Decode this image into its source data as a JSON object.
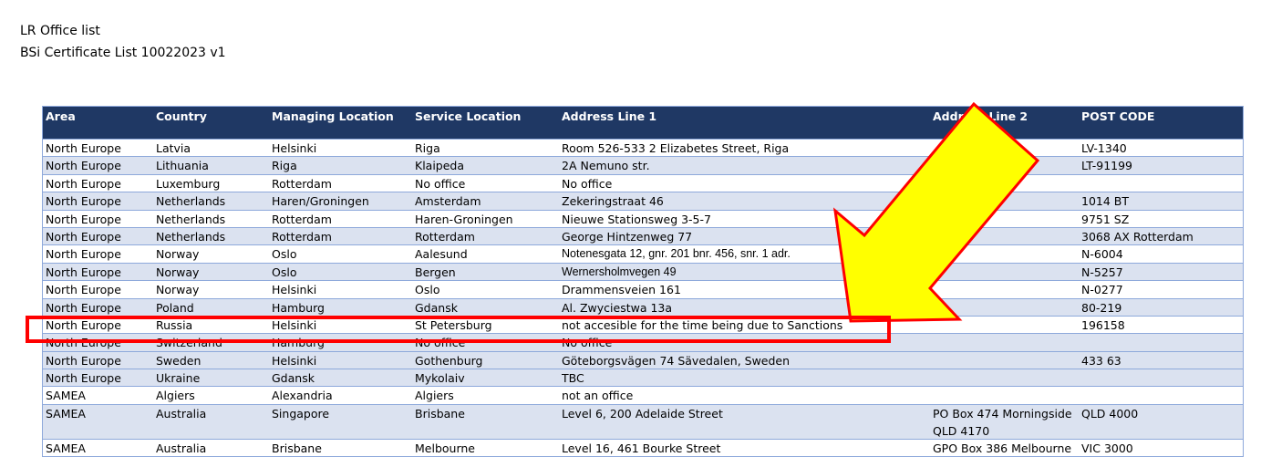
{
  "document": {
    "title_line1": "LR Office list",
    "title_line2": "BSi Certificate List 10022023 v1"
  },
  "table": {
    "headers": [
      "Area",
      "Country",
      "Managing Location",
      "Service Location",
      "Address Line 1",
      "Address Line 2",
      "POST CODE"
    ],
    "rows": [
      {
        "cells": [
          "North Europe",
          "Latvia",
          "Helsinki",
          "Riga",
          "Room 526-533  2 Elizabetes Street, Riga",
          "",
          "LV-1340"
        ]
      },
      {
        "cells": [
          "North Europe",
          "Lithuania",
          "Riga",
          "Klaipeda",
          "2A Nemuno str.",
          "",
          "LT-91199"
        ]
      },
      {
        "cells": [
          "North Europe",
          "Luxemburg",
          "Rotterdam",
          "No office",
          "No office",
          "",
          ""
        ]
      },
      {
        "cells": [
          "North Europe",
          "Netherlands",
          "Haren/Groningen",
          "Amsterdam",
          "Zekeringstraat 46",
          "",
          " 1014 BT"
        ]
      },
      {
        "cells": [
          "North Europe",
          "Netherlands",
          "Rotterdam",
          "Haren-Groningen",
          "Nieuwe Stationsweg 3-5-7",
          "",
          " 9751 SZ"
        ]
      },
      {
        "cells": [
          "North Europe",
          "Netherlands",
          "Rotterdam",
          "Rotterdam",
          "George Hintzenweg 77",
          "",
          "3068 AX Rotterdam"
        ]
      },
      {
        "cells": [
          "North Europe",
          "Norway",
          "Oslo",
          "Aalesund",
          "Notenesgata 12, gnr. 201 bnr. 456, snr. 1 adr.",
          "",
          " N-6004"
        ]
      },
      {
        "cells": [
          "North Europe",
          "Norway",
          "Oslo",
          "Bergen",
          "Wernersholmvegen 49",
          "",
          " N-5257"
        ]
      },
      {
        "cells": [
          "North Europe",
          "Norway",
          "Helsinki",
          "Oslo",
          "Drammensveien 161",
          "",
          " N-0277"
        ]
      },
      {
        "cells": [
          "North Europe",
          "Poland",
          "Hamburg",
          "Gdansk",
          "Al. Zwyciestwa 13a",
          "",
          " 80-219"
        ]
      },
      {
        "cells": [
          "North Europe",
          "Russia",
          "Helsinki",
          "St Petersburg",
          "not accesible for the time being due to Sanctions",
          "",
          "196158"
        ]
      },
      {
        "cells": [
          "North Europe",
          "Switzerland",
          "Hamburg",
          "No office",
          "No office",
          "",
          ""
        ]
      },
      {
        "cells": [
          "North Europe",
          "Sweden",
          "Helsinki",
          "Gothenburg",
          "Göteborgsvägen 74 Sävedalen, Sweden",
          "",
          " 433 63"
        ]
      },
      {
        "cells": [
          "North Europe",
          "Ukraine",
          "Gdansk",
          "Mykolaiv",
          "TBC",
          "",
          ""
        ]
      },
      {
        "cells": [
          "SAMEA",
          "Algiers",
          "Alexandria",
          "Algiers",
          "not an office",
          "",
          ""
        ]
      },
      {
        "cells": [
          "SAMEA",
          "Australia",
          "Singapore",
          "Brisbane",
          "Level 6, 200 Adelaide Street",
          "PO Box 474  Morningside",
          "QLD 4000"
        ],
        "cell5_line2": "QLD  4170"
      },
      {
        "cells": [
          "SAMEA",
          "Australia",
          "Brisbane",
          "Melbourne",
          "Level 16, 461 Bourke Street",
          "GPO Box 386 Melbourne",
          " VIC 3000"
        ]
      }
    ]
  },
  "annotations": {
    "highlight_color": "#ff0000",
    "arrow_fill": "#ffff00",
    "arrow_stroke": "#ff0000",
    "highlight_row": "Russia"
  }
}
